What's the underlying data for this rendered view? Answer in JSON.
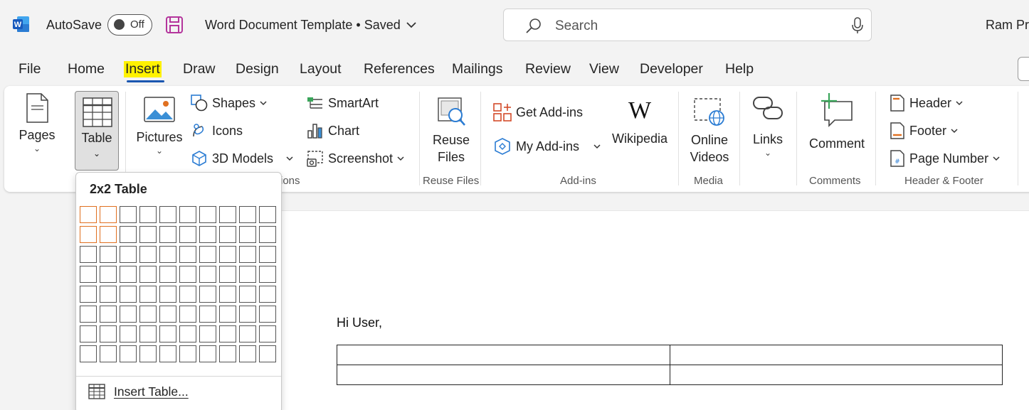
{
  "titlebar": {
    "autosave_label": "AutoSave",
    "autosave_state": "Off",
    "doc_title": "Word Document Template • Saved",
    "search_placeholder": "Search",
    "user_name": "Ram Pr"
  },
  "tabs": [
    {
      "label": "File"
    },
    {
      "label": "Home"
    },
    {
      "label": "Insert"
    },
    {
      "label": "Draw"
    },
    {
      "label": "Design"
    },
    {
      "label": "Layout"
    },
    {
      "label": "References"
    },
    {
      "label": "Mailings"
    },
    {
      "label": "Review"
    },
    {
      "label": "View"
    },
    {
      "label": "Developer"
    },
    {
      "label": "Help"
    }
  ],
  "ribbon": {
    "pages": "Pages",
    "table": "Table",
    "pictures": "Pictures",
    "shapes": "Shapes",
    "icons": "Icons",
    "models3d": "3D Models",
    "smartart": "SmartArt",
    "chart": "Chart",
    "screenshot": "Screenshot",
    "reuse_files_line1": "Reuse",
    "reuse_files_line2": "Files",
    "get_addins": "Get Add-ins",
    "my_addins": "My Add-ins",
    "wikipedia": "Wikipedia",
    "online_videos_line1": "Online",
    "online_videos_line2": "Videos",
    "links": "Links",
    "comment": "Comment",
    "header": "Header",
    "footer": "Footer",
    "page_number": "Page Number",
    "groups": {
      "illustrations": "ions",
      "reuse_files": "Reuse Files",
      "addins": "Add-ins",
      "media": "Media",
      "comments": "Comments",
      "header_footer": "Header & Footer"
    }
  },
  "table_dropdown": {
    "title": "2x2 Table",
    "grid_cols": 10,
    "grid_rows": 8,
    "selected_cols": 2,
    "selected_rows": 2,
    "insert_table": "Insert Table..."
  },
  "document": {
    "greeting": "Hi User,",
    "table_rows": 2,
    "table_cols": 2
  },
  "colors": {
    "accent": "#1a56b0",
    "highlight": "#fff200",
    "selection": "#e07020",
    "word_blue": "#185abd",
    "save_icon": "#b4359c"
  }
}
